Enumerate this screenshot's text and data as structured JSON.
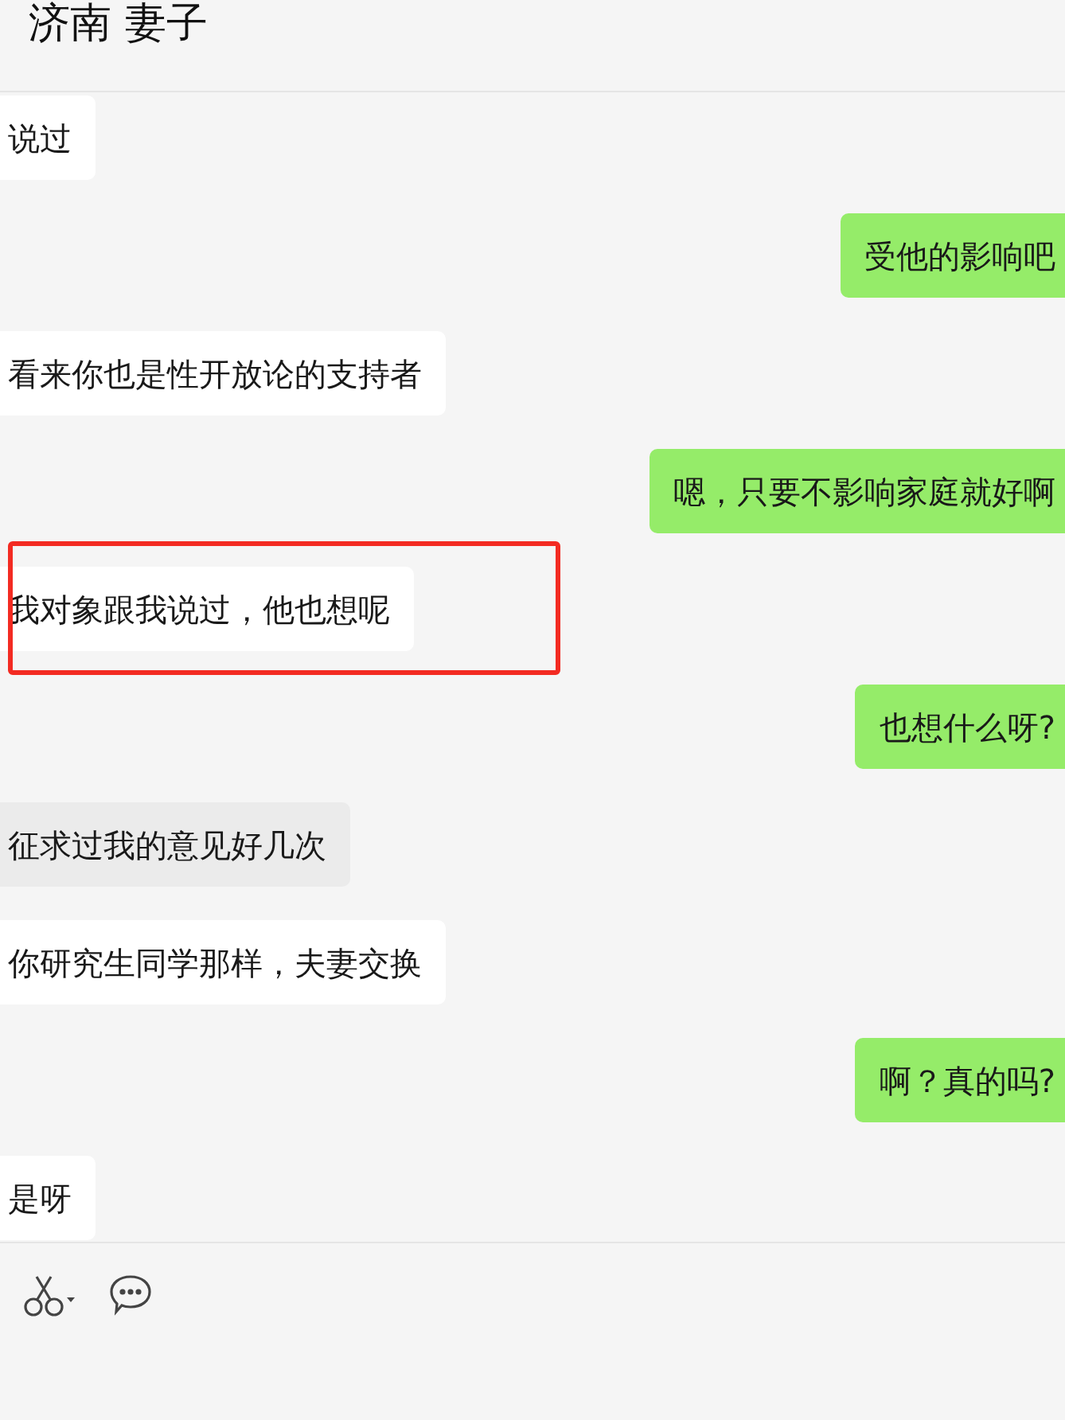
{
  "header": {
    "title": "济南 妻子"
  },
  "messages": [
    {
      "kind": "received",
      "text": "说过",
      "hovered": false,
      "highlighted": false
    },
    {
      "kind": "sent",
      "text": "受他的影响吧"
    },
    {
      "kind": "received",
      "text": "看来你也是性开放论的支持者",
      "hovered": false,
      "highlighted": false
    },
    {
      "kind": "sent",
      "text": "嗯，只要不影响家庭就好啊"
    },
    {
      "kind": "received",
      "text": "我对象跟我说过，他也想呢",
      "hovered": false,
      "highlighted": true
    },
    {
      "kind": "sent",
      "text": "也想什么呀?"
    },
    {
      "kind": "received",
      "text": "征求过我的意见好几次",
      "hovered": true,
      "highlighted": false
    },
    {
      "kind": "received",
      "text": "你研究生同学那样，夫妻交换",
      "hovered": false,
      "highlighted": false
    },
    {
      "kind": "sent",
      "text": "啊？真的吗?"
    },
    {
      "kind": "received",
      "text": "是呀",
      "hovered": false,
      "highlighted": false
    }
  ]
}
